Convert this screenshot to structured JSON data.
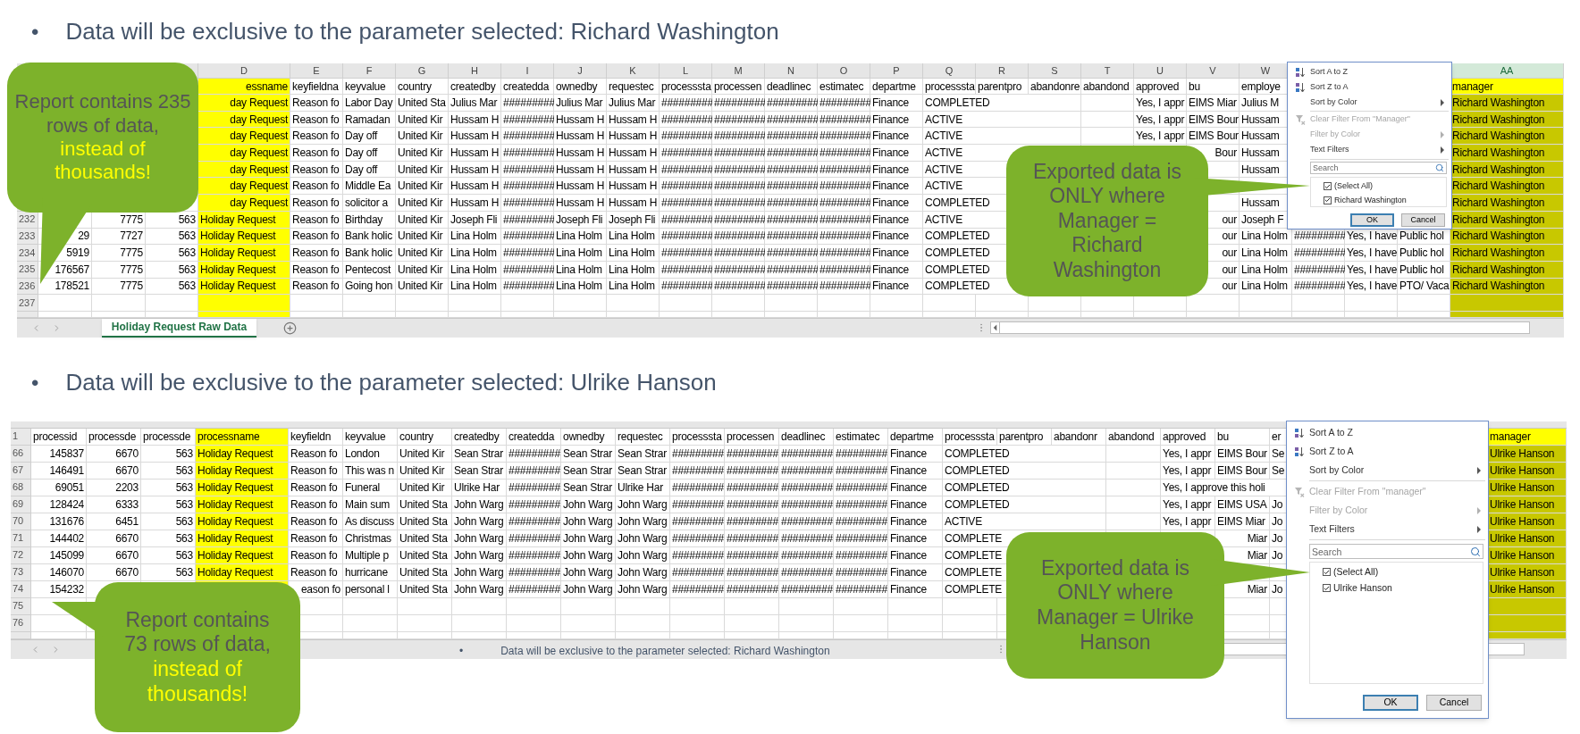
{
  "sections": [
    {
      "bullet": "•",
      "heading": "Data will be exclusive to the parameter selected: Richard Washington",
      "sheet": {
        "column_letters": {
          "D": "D",
          "E": "E",
          "F": "F",
          "G": "G",
          "H": "H",
          "I": "I",
          "J": "J",
          "K": "K",
          "L": "L",
          "M": "M",
          "N": "N",
          "O": "O",
          "P": "P",
          "Q": "Q",
          "R": "R",
          "S": "S",
          "T": "T",
          "U": "U",
          "V": "V",
          "W": "W",
          "AA": "AA"
        },
        "header": {
          "cells": {
            "D": {
              "text": "essname",
              "clipped": true
            },
            "E": "keyfieldna",
            "F": "keyvalue",
            "G": "country",
            "H": "createdby",
            "I": "createdda",
            "J": "ownedby",
            "K": "requestec",
            "L": "processsta",
            "M": "processen",
            "N": "deadlinec",
            "O": "estimatec",
            "P": "departme",
            "Q": "processsta",
            "R": "parentpro",
            "S": "abandonre",
            "T": "abandond",
            "U": "approved",
            "V": "bu",
            "W": "employe",
            "AA": "manager"
          }
        },
        "rows": [
          {
            "cells": {
              "D": {
                "text": "day Request",
                "clipped": true
              },
              "E": "Reason fo",
              "F": "Labor Day",
              "G": "United Sta",
              "H": "Julius Mar",
              "I": "#########",
              "J": "Julius Mar",
              "K": "Julius Mar",
              "L": "#########",
              "M": "#########",
              "N": "#########",
              "O": "#########",
              "P": "Finance",
              "Q": "COMPLETED",
              "U": "Yes, I appr",
              "V": "EIMS Miar",
              "W": "Julius M",
              "AA": "Richard Washington"
            }
          },
          {
            "cells": {
              "D": {
                "text": "day Request",
                "clipped": true
              },
              "E": "Reason fo",
              "F": "Ramadan",
              "G": "United Kir",
              "H": "Hussam H",
              "I": "#########",
              "J": "Hussam H",
              "K": "Hussam H",
              "L": "#########",
              "M": "#########",
              "N": "#########",
              "O": "#########",
              "P": "Finance",
              "Q": "ACTIVE",
              "U": "Yes, I appr",
              "V": "EIMS Bour",
              "W": "Hussam",
              "AA": "Richard Washington"
            }
          },
          {
            "cells": {
              "D": {
                "text": "day Request",
                "clipped": true
              },
              "E": "Reason fo",
              "F": "Day off",
              "G": "United Kir",
              "H": "Hussam H",
              "I": "#########",
              "J": "Hussam H",
              "K": "Hussam H",
              "L": "#########",
              "M": "#########",
              "N": "#########",
              "O": "#########",
              "P": "Finance",
              "Q": "ACTIVE",
              "U": "Yes, I appr",
              "V": "EIMS Bour",
              "W": "Hussam",
              "AA": "Richard Washington"
            }
          },
          {
            "cells": {
              "D": {
                "text": "day Request",
                "clipped": true
              },
              "E": "Reason fo",
              "F": "Day off",
              "G": "United Kir",
              "H": "Hussam H",
              "I": "#########",
              "J": "Hussam H",
              "K": "Hussam H",
              "L": "#########",
              "M": "#########",
              "N": "#########",
              "O": "#########",
              "P": "Finance",
              "Q": "ACTIVE",
              "V": {
                "text": "Bour",
                "clipped": true
              },
              "W": "Hussam",
              "AA": "Richard Washington"
            }
          },
          {
            "cells": {
              "D": {
                "text": "day Request",
                "clipped": true
              },
              "E": "Reason fo",
              "F": "Day off",
              "G": "United Kir",
              "H": "Hussam H",
              "I": "#########",
              "J": "Hussam H",
              "K": "Hussam H",
              "L": "#########",
              "M": "#########",
              "N": "#########",
              "O": "#########",
              "P": "Finance",
              "Q": "ACTIVE",
              "W": "Hussam",
              "AA": "Richard Washington"
            }
          },
          {
            "cells": {
              "D": {
                "text": "day Request",
                "clipped": true
              },
              "E": "Reason fo",
              "F": "Middle Ea",
              "G": "United Kir",
              "H": "Hussam H",
              "I": "#########",
              "J": "Hussam H",
              "K": "Hussam H",
              "L": "#########",
              "M": "#########",
              "N": "#########",
              "O": "#########",
              "P": "Finance",
              "Q": "ACTIVE",
              "AA": "Richard Washington"
            }
          },
          {
            "cells": {
              "D": {
                "text": "day Request",
                "clipped": true
              },
              "E": "Reason fo",
              "F": "solicitor a",
              "G": "United Kir",
              "H": "Hussam H",
              "I": "#########",
              "J": "Hussam H",
              "K": "Hussam H",
              "L": "#########",
              "M": "#########",
              "N": "#########",
              "O": "#########",
              "P": "Finance",
              "Q": "COMPLETED",
              "W": "Hussam",
              "AA": "Richard Washington"
            }
          },
          {
            "number": "232",
            "cells": {
              "B": "7775",
              "C": "563",
              "D": "Holiday Request",
              "E": "Reason fo",
              "F": "Birthday",
              "G": "United Kir",
              "H": "Joseph Fli",
              "I": "#########",
              "J": "Joseph Fli",
              "K": "Joseph Fli",
              "L": "#########",
              "M": "#########",
              "N": "#########",
              "O": "#########",
              "P": "Finance",
              "Q": "ACTIVE",
              "V": {
                "text": "our",
                "clipped": true
              },
              "W": "Joseph F",
              "AA": "Richard Washington"
            }
          },
          {
            "number": "233",
            "cells": {
              "A": "29",
              "B": "7727",
              "C": "563",
              "D": "Holiday Request",
              "E": "Reason fo",
              "F": "Bank holic",
              "G": "United Kir",
              "H": "Lina Holm",
              "I": "#########",
              "J": "Lina Holm",
              "K": "Lina Holm",
              "L": "#########",
              "M": "#########",
              "N": "#########",
              "O": "#########",
              "P": "Finance",
              "Q": "COMPLETED",
              "V": {
                "text": "our",
                "clipped": true
              },
              "W": "Lina Holm",
              "X": "#########",
              "Y": "Yes, I have",
              "Z": "Public hol",
              "AA": "Richard Washington"
            }
          },
          {
            "number": "234",
            "cells": {
              "A": "5919",
              "B": "7775",
              "C": "563",
              "D": "Holiday Request",
              "E": "Reason fo",
              "F": "Bank holic",
              "G": "United Kir",
              "H": "Lina Holm",
              "I": "#########",
              "J": "Lina Holm",
              "K": "Lina Holm",
              "L": "#########",
              "M": "#########",
              "N": "#########",
              "O": "#########",
              "P": "Finance",
              "Q": "COMPLETED",
              "V": {
                "text": "our",
                "clipped": true
              },
              "W": "Lina Holm",
              "X": "#########",
              "Y": "Yes, I have",
              "Z": "Public hol",
              "AA": "Richard Washington"
            }
          },
          {
            "number": "235",
            "cells": {
              "A": "176567",
              "B": "7775",
              "C": "563",
              "D": "Holiday Request",
              "E": "Reason fo",
              "F": "Pentecost",
              "G": "United Kir",
              "H": "Lina Holm",
              "I": "#########",
              "J": "Lina Holm",
              "K": "Lina Holm",
              "L": "#########",
              "M": "#########",
              "N": "#########",
              "O": "#########",
              "P": "Finance",
              "Q": "COMPLETED",
              "V": {
                "text": "our",
                "clipped": true
              },
              "W": "Lina Holm",
              "X": "#########",
              "Y": "Yes, I have",
              "Z": "Public hol",
              "AA": "Richard Washington"
            }
          },
          {
            "number": "236",
            "cells": {
              "A": "178521",
              "B": "7775",
              "C": "563",
              "D": "Holiday Request",
              "E": "Reason fo",
              "F": "Going hon",
              "G": "United Kir",
              "H": "Lina Holm",
              "I": "#########",
              "J": "Lina Holm",
              "K": "Lina Holm",
              "L": "#########",
              "M": "#########",
              "N": "#########",
              "O": "#########",
              "P": "Finance",
              "Q": "COMPLETED",
              "V": {
                "text": "our",
                "clipped": true
              },
              "W": "Lina Holm",
              "X": "#########",
              "Y": "Yes, I have",
              "Z": "PTO/ Vaca",
              "AA": "Richard Washington"
            }
          },
          {
            "number": "237"
          }
        ],
        "tabs": [
          {
            "label": "Holiday Request Raw Data",
            "selected": true
          }
        ]
      },
      "filter_menu": {
        "items": [
          {
            "kind": "sort_ascending",
            "label": "Sort A to Z",
            "disabled": false,
            "submenu": false
          },
          {
            "kind": "sort_descending",
            "label": "Sort Z to A",
            "disabled": false,
            "submenu": false
          },
          {
            "kind": "plain",
            "label": "Sort by Color",
            "disabled": false,
            "submenu": true
          },
          {
            "kind": "clear_filter",
            "label": "Clear Filter From \"Manager\"",
            "disabled": true,
            "submenu": false
          },
          {
            "kind": "plain",
            "label": "Filter by Color",
            "disabled": true,
            "submenu": true
          },
          {
            "kind": "plain",
            "label": "Text Filters",
            "disabled": false,
            "submenu": true
          }
        ],
        "search_placeholder": "Search",
        "options": [
          {
            "label": "(Select All)",
            "checked": true
          },
          {
            "label": "Richard Washington",
            "checked": true
          }
        ],
        "buttons": [
          {
            "label": "OK",
            "default": true
          },
          {
            "label": "Cancel",
            "default": false
          }
        ]
      },
      "callouts": [
        {
          "lines": [
            {
              "text": "Report contains 235 rows of data,",
              "highlight": false
            },
            {
              "text": "instead of thousands!",
              "highlight": true
            }
          ]
        },
        {
          "lines": [
            {
              "text": "Exported data is ONLY where Manager = Richard Washington",
              "highlight": false
            }
          ]
        }
      ]
    },
    {
      "bullet": "•",
      "heading": "Data will be exclusive to the parameter selected: Ulrike Hanson",
      "sheet": {
        "header": {
          "number": "1",
          "cells": {
            "A": "processid",
            "B": "processde",
            "C": "processde",
            "D": "processname",
            "E": "keyfieldn",
            "F": "keyvalue",
            "G": "country",
            "H": "createdby",
            "I": "createdda",
            "J": "ownedby",
            "K": "requestec",
            "L": "processsta",
            "M": "processen",
            "N": "deadlinec",
            "O": "estimatec",
            "P": "departme",
            "Q": "processsta",
            "R": "parentpro",
            "S": "abandonr",
            "T": "abandond",
            "U": "approved",
            "V": "bu",
            "W": "er",
            "AA": "manager"
          }
        },
        "rows": [
          {
            "number": "66",
            "cells": {
              "A": "145837",
              "B": "6670",
              "C": "563",
              "D": "Holiday Request",
              "E": "Reason fo",
              "F": "London",
              "G": "United Kir",
              "H": "Sean Strar",
              "I": "#########",
              "J": "Sean Strar",
              "K": "Sean Strar",
              "L": "#########",
              "M": "#########",
              "N": "#########",
              "O": "#########",
              "P": "Finance",
              "Q": "COMPLETED",
              "U": "Yes, I appr",
              "V": "EIMS Bour",
              "W": "Se",
              "AA": "Ulrike Hanson"
            }
          },
          {
            "number": "67",
            "cells": {
              "A": "146491",
              "B": "6670",
              "C": "563",
              "D": "Holiday Request",
              "E": "Reason fo",
              "F": "This was n",
              "G": "United Kir",
              "H": "Sean Strar",
              "I": "#########",
              "J": "Sean Strar",
              "K": "Sean Strar",
              "L": "#########",
              "M": "#########",
              "N": "#########",
              "O": "#########",
              "P": "Finance",
              "Q": "COMPLETED",
              "U": "Yes, I appr",
              "V": "EIMS Bour",
              "W": "Se",
              "AA": "Ulrike Hanson"
            }
          },
          {
            "number": "68",
            "cells": {
              "A": "69051",
              "B": "2203",
              "C": "563",
              "D": "Holiday Request",
              "E": "Reason fo",
              "F": "Funeral",
              "G": "United Kir",
              "H": "Ulrike Har",
              "I": "#########",
              "J": "Sean Strar",
              "K": "Ulrike Har",
              "L": "#########",
              "M": "#########",
              "N": "#########",
              "O": "#########",
              "P": "Finance",
              "Q": "COMPLETED",
              "U": "Yes, I approve this holi",
              "AA": "Ulrike Hanson"
            }
          },
          {
            "number": "69",
            "cells": {
              "A": "128424",
              "B": "6333",
              "C": "563",
              "D": "Holiday Request",
              "E": "Reason fo",
              "F": "Main sum",
              "G": "United Sta",
              "H": "John Warg",
              "I": "#########",
              "J": "John Warg",
              "K": "John Warg",
              "L": "#########",
              "M": "#########",
              "N": "#########",
              "O": "#########",
              "P": "Finance",
              "Q": "COMPLETED",
              "U": "Yes, I appr",
              "V": "EIMS USA",
              "W": "Jo",
              "AA": "Ulrike Hanson"
            }
          },
          {
            "number": "70",
            "cells": {
              "A": "131676",
              "B": "6451",
              "C": "563",
              "D": "Holiday Request",
              "E": "Reason fo",
              "F": "As discuss",
              "G": "United Sta",
              "H": "John Warg",
              "I": "#########",
              "J": "John Warg",
              "K": "John Warg",
              "L": "#########",
              "M": "#########",
              "N": "#########",
              "O": "#########",
              "P": "Finance",
              "Q": "ACTIVE",
              "U": "Yes, I appr",
              "V": "EIMS Miar",
              "W": "Jo",
              "AA": "Ulrike Hanson"
            }
          },
          {
            "number": "71",
            "cells": {
              "A": "144402",
              "B": "6670",
              "C": "563",
              "D": "Holiday Request",
              "E": "Reason fo",
              "F": "Christmas",
              "G": "United Sta",
              "H": "John Warg",
              "I": "#########",
              "J": "John Warg",
              "K": "John Warg",
              "L": "#########",
              "M": "#########",
              "N": "#########",
              "O": "#########",
              "P": "Finance",
              "Q": "COMPLETE",
              "V": {
                "text": "Miar",
                "clipped": true
              },
              "W": "Jo",
              "AA": "Ulrike Hanson"
            }
          },
          {
            "number": "72",
            "cells": {
              "A": "145099",
              "B": "6670",
              "C": "563",
              "D": "Holiday Request",
              "E": "Reason fo",
              "F": "Multiple p",
              "G": "United Sta",
              "H": "John Warg",
              "I": "#########",
              "J": "John Warg",
              "K": "John Warg",
              "L": "#########",
              "M": "#########",
              "N": "#########",
              "O": "#########",
              "P": "Finance",
              "Q": "COMPLETE",
              "V": {
                "text": "Miar",
                "clipped": true
              },
              "W": "Jo",
              "AA": "Ulrike Hanson"
            }
          },
          {
            "number": "73",
            "cells": {
              "A": "146070",
              "B": "6670",
              "C": "563",
              "D": "Holiday Request",
              "E": "Reason fo",
              "F": "hurricane",
              "G": "United Sta",
              "H": "John Warg",
              "I": "#########",
              "J": "John Warg",
              "K": "John Warg",
              "L": "#########",
              "M": "#########",
              "N": "#########",
              "O": "#########",
              "P": "Finance",
              "Q": "COMPLETE",
              "AA": "Ulrike Hanson"
            }
          },
          {
            "number": "74",
            "cells": {
              "A": "154232",
              "E": {
                "text": "eason fo",
                "clipped": true
              },
              "F": "personal l",
              "G": "United Sta",
              "H": "John Warg",
              "I": "#########",
              "J": "John Warg",
              "K": "John Warg",
              "L": "#########",
              "M": "#########",
              "N": "#########",
              "O": "#########",
              "P": "Finance",
              "Q": "COMPLETE",
              "V": {
                "text": "Miar",
                "clipped": true
              },
              "W": "Jo",
              "AA": "Ulrike Hanson"
            }
          },
          {
            "number": "75"
          },
          {
            "number": "76"
          }
        ],
        "overlay_note": {
          "bullet": "•",
          "text": "Data will be exclusive to the parameter selected: Richard Washington"
        }
      },
      "filter_menu": {
        "items": [
          {
            "kind": "sort_ascending",
            "label": "Sort A to Z",
            "disabled": false,
            "submenu": false
          },
          {
            "kind": "sort_descending",
            "label": "Sort Z to A",
            "disabled": false,
            "submenu": false
          },
          {
            "kind": "plain",
            "label": "Sort by Color",
            "disabled": false,
            "submenu": true
          },
          {
            "kind": "clear_filter",
            "label": "Clear Filter From \"manager\"",
            "disabled": true,
            "submenu": false
          },
          {
            "kind": "plain",
            "label": "Filter by Color",
            "disabled": true,
            "submenu": true
          },
          {
            "kind": "plain",
            "label": "Text Filters",
            "disabled": false,
            "submenu": true
          }
        ],
        "search_placeholder": "Search",
        "options": [
          {
            "label": "(Select All)",
            "checked": true
          },
          {
            "label": "Ulrike Hanson",
            "checked": true
          }
        ],
        "buttons": [
          {
            "label": "OK",
            "default": true
          },
          {
            "label": "Cancel",
            "default": false
          }
        ]
      },
      "callouts": [
        {
          "lines": [
            {
              "text": "Report contains 73 rows of data,",
              "highlight": false
            },
            {
              "text": "instead of thousands!",
              "highlight": true
            }
          ]
        },
        {
          "lines": [
            {
              "text": "Exported data is ONLY where Manager = Ulrike Hanson",
              "highlight": false
            }
          ]
        }
      ]
    }
  ]
}
